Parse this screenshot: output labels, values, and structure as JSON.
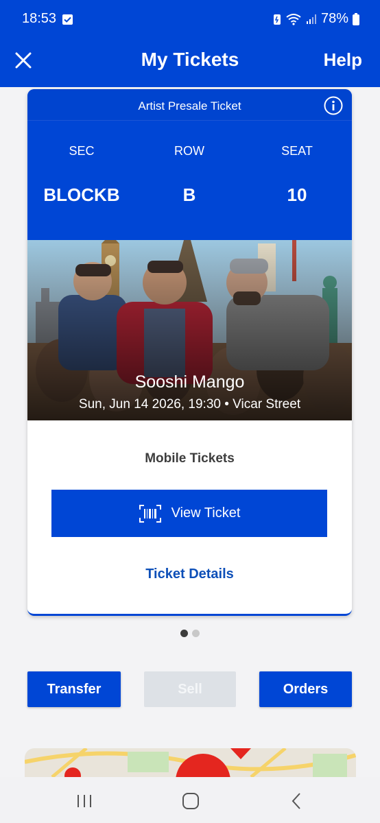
{
  "status_bar": {
    "time": "18:53",
    "battery": "78%"
  },
  "header": {
    "title": "My Tickets",
    "help_label": "Help",
    "close_icon": "close-icon"
  },
  "ticket": {
    "type_label": "Artist Presale Ticket",
    "info_icon": "info-icon",
    "sec_label": "SEC",
    "row_label": "ROW",
    "seat_label": "SEAT",
    "sec_value": "BLOCKB",
    "row_value": "B",
    "seat_value": "10",
    "event_name": "Sooshi Mango",
    "event_meta": "Sun, Jun 14 2026, 19:30 • Vicar Street",
    "mobile_label": "Mobile Tickets",
    "view_ticket_label": "View Ticket",
    "view_ticket_icon": "barcode-scan-icon",
    "details_label": "Ticket Details"
  },
  "pagination": {
    "count": 2,
    "active": 1
  },
  "actions": {
    "transfer_label": "Transfer",
    "sell_label": "Sell",
    "orders_label": "Orders"
  },
  "colors": {
    "brand_blue": "#0046d5",
    "link_blue": "#0d4fb8",
    "disabled_gray": "#dde1e6"
  },
  "nav_bar": {
    "recents_icon": "recents-icon",
    "home_icon": "home-icon",
    "back_icon": "back-icon"
  }
}
